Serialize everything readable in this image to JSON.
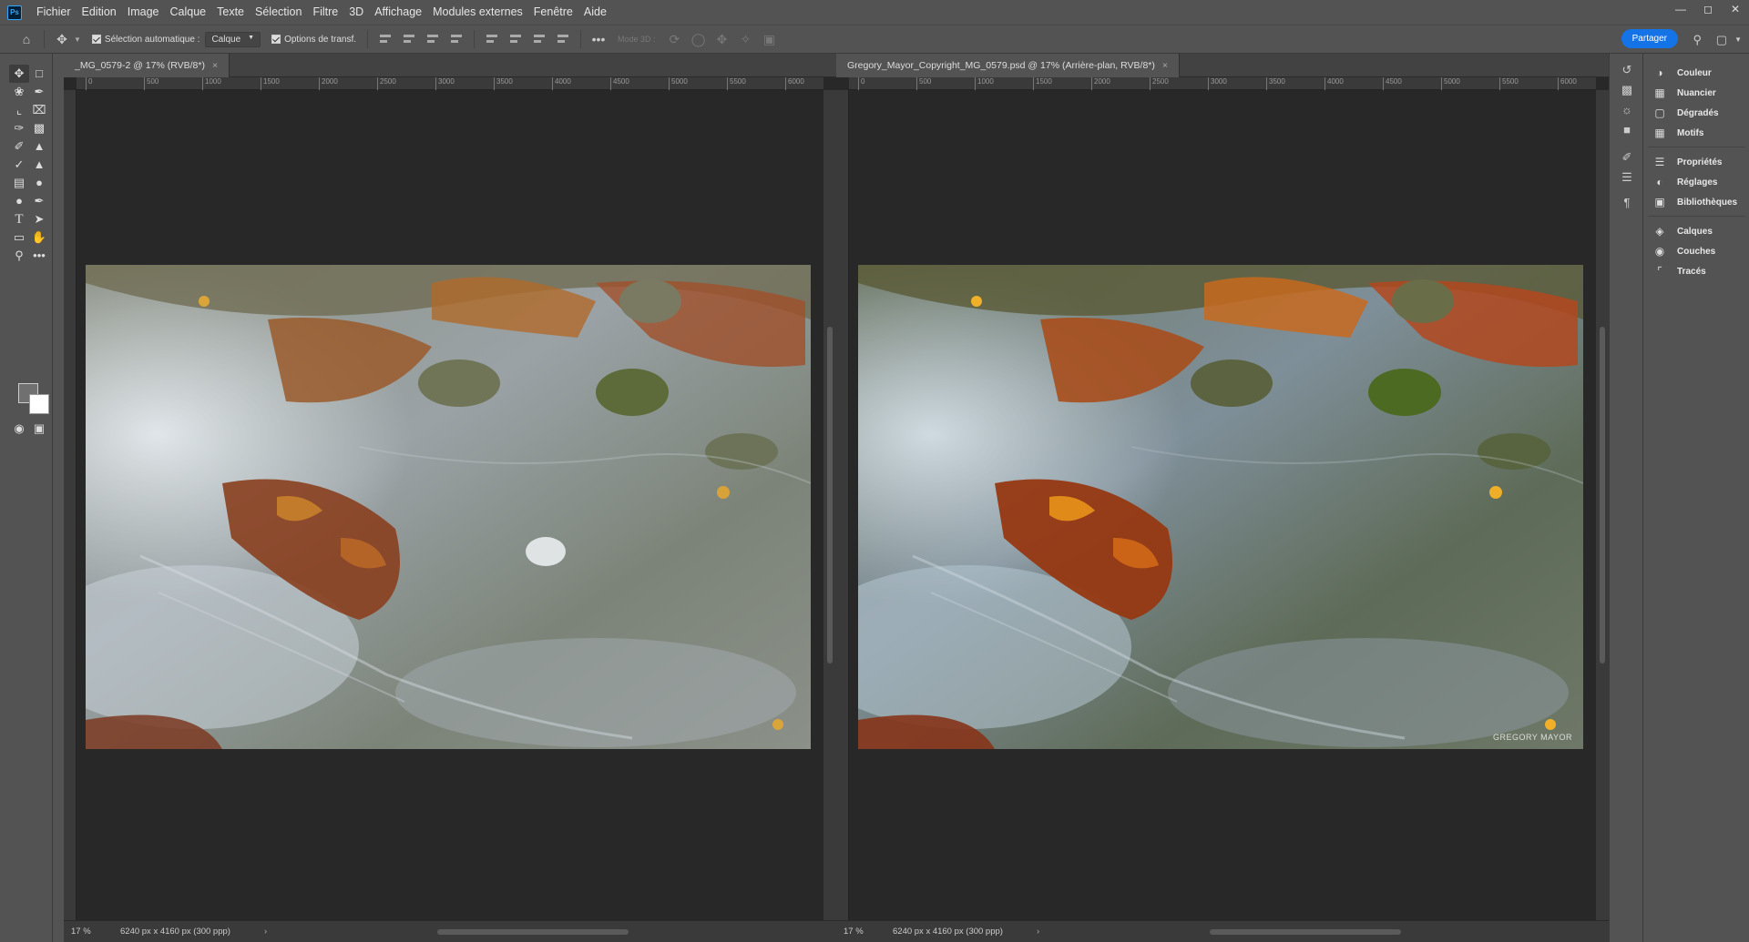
{
  "menubar": {
    "items": [
      "Fichier",
      "Edition",
      "Image",
      "Calque",
      "Texte",
      "Sélection",
      "Filtre",
      "3D",
      "Affichage",
      "Modules externes",
      "Fenêtre",
      "Aide"
    ]
  },
  "options": {
    "auto_select_label": "Sélection automatique :",
    "auto_select_value": "Calque",
    "transform_label": "Options de transf.",
    "mode3d": "Mode 3D :",
    "share": "Partager"
  },
  "documents": [
    {
      "tab": "_MG_0579-2 @ 17% (RVB/8*)",
      "zoom": "17 %",
      "info": "6240 px x 4160 px (300 ppp)",
      "ruler_labels": [
        "0",
        "500",
        "1000",
        "1500",
        "2000",
        "2500",
        "3000",
        "3500",
        "4000",
        "4500",
        "5000",
        "5500",
        "6000"
      ]
    },
    {
      "tab": "Gregory_Mayor_Copyright_MG_0579.psd @ 17% (Arrière-plan, RVB/8*)",
      "zoom": "17 %",
      "info": "6240 px x 4160 px (300 ppp)",
      "watermark": "GREGORY MAYOR",
      "ruler_labels": [
        "0",
        "500",
        "1000",
        "1500",
        "2000",
        "2500",
        "3000",
        "3500",
        "4000",
        "4500",
        "5000",
        "5500",
        "6000"
      ]
    }
  ],
  "panels": [
    {
      "label": "Couleur",
      "icon": "color-wheel-icon"
    },
    {
      "label": "Nuancier",
      "icon": "swatches-grid-icon"
    },
    {
      "label": "Dégradés",
      "icon": "gradient-icon"
    },
    {
      "label": "Motifs",
      "icon": "patterns-grid-icon"
    },
    {
      "label": "Propriétés",
      "icon": "sliders-icon"
    },
    {
      "label": "Réglages",
      "icon": "adjustments-circle-icon"
    },
    {
      "label": "Bibliothèques",
      "icon": "libraries-icon"
    },
    {
      "label": "Calques",
      "icon": "layers-icon"
    },
    {
      "label": "Couches",
      "icon": "channels-icon"
    },
    {
      "label": "Tracés",
      "icon": "paths-icon"
    }
  ]
}
